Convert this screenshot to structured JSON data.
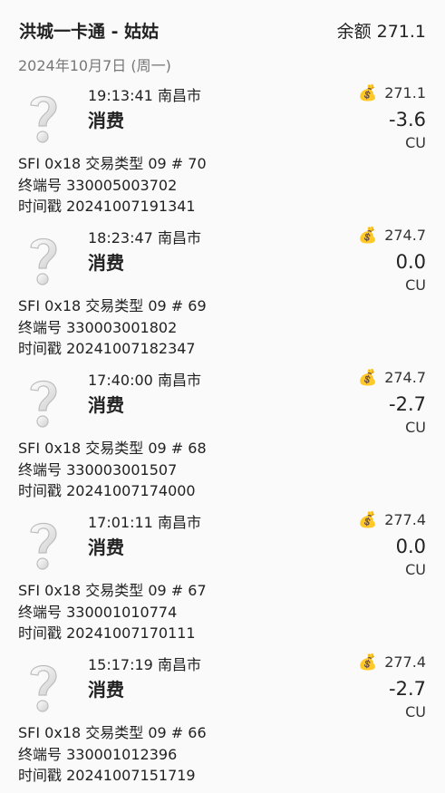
{
  "header": {
    "title": "洪城一卡通 - 姑姑",
    "balance_label": "余额 271.1"
  },
  "date": "2024年10月7日 (周一)",
  "transactions": [
    {
      "time_location": "19:13:41  南昌市",
      "kind": "消费",
      "balance": "271.1",
      "amount": "-3.6",
      "unit": "CU",
      "sfi_line": "SFI 0x18  交易类型 09  # 70",
      "terminal_line": "终端号 330005003702",
      "timestamp_line": "时间戳 20241007191341"
    },
    {
      "time_location": "18:23:47  南昌市",
      "kind": "消费",
      "balance": "274.7",
      "amount": "0.0",
      "unit": "CU",
      "sfi_line": "SFI 0x18  交易类型 09  # 69",
      "terminal_line": "终端号 330003001802",
      "timestamp_line": "时间戳 20241007182347"
    },
    {
      "time_location": "17:40:00  南昌市",
      "kind": "消费",
      "balance": "274.7",
      "amount": "-2.7",
      "unit": "CU",
      "sfi_line": "SFI 0x18  交易类型 09  # 68",
      "terminal_line": "终端号 330003001507",
      "timestamp_line": "时间戳 20241007174000"
    },
    {
      "time_location": "17:01:11  南昌市",
      "kind": "消费",
      "balance": "277.4",
      "amount": "0.0",
      "unit": "CU",
      "sfi_line": "SFI 0x18  交易类型 09  # 67",
      "terminal_line": "终端号 330001010774",
      "timestamp_line": "时间戳 20241007170111"
    },
    {
      "time_location": "15:17:19  南昌市",
      "kind": "消费",
      "balance": "277.4",
      "amount": "-2.7",
      "unit": "CU",
      "sfi_line": "SFI 0x18  交易类型 09  # 66",
      "terminal_line": "终端号 330001012396",
      "timestamp_line": "时间戳 20241007151719"
    }
  ],
  "icons": {
    "transaction_icon": "question-mark-icon",
    "balance_icon": "money-bag-icon"
  }
}
